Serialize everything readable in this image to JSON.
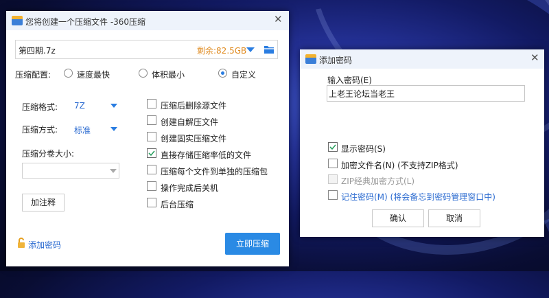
{
  "colors": {
    "accent": "#2a7de1",
    "free_space": "#e08b20",
    "title_bar": "#eef3fb",
    "wallpaper": "#121a63"
  },
  "compress_window": {
    "title": "您将创建一个压缩文件 -360压缩",
    "filename": "第四期.7z",
    "free_space": "剩余:82.5GB",
    "config_label": "压缩配置:",
    "config_options": [
      "速度最快",
      "体积最小",
      "自定义"
    ],
    "config_selected": "自定义",
    "format_label": "压缩格式:",
    "format_value": "7Z",
    "method_label": "压缩方式:",
    "method_value": "标准",
    "split_label": "压缩分卷大小:",
    "split_value": "",
    "comment_button": "加注释",
    "options": [
      {
        "label": "压缩后删除源文件",
        "checked": false
      },
      {
        "label": "创建自解压文件",
        "checked": false
      },
      {
        "label": "创建固实压缩文件",
        "checked": false
      },
      {
        "label": "直接存储压缩率低的文件",
        "checked": true
      },
      {
        "label": "压缩每个文件到单独的压缩包",
        "checked": false
      },
      {
        "label": "操作完成后关机",
        "checked": false
      },
      {
        "label": "后台压缩",
        "checked": false
      }
    ],
    "add_password_link": "添加密码",
    "compress_button": "立即压缩",
    "icons": [
      "archive-icon",
      "close-icon",
      "dropdown-arrow-icon",
      "folder-icon",
      "lock-icon"
    ]
  },
  "password_dialog": {
    "title": "添加密码",
    "input_label": "输入密码(E)",
    "password_value": "上老王论坛当老王",
    "show_password": {
      "label": "显示密码(S)",
      "checked": true
    },
    "encrypt_filename": {
      "label": "加密文件名(N) (不支持ZIP格式)",
      "checked": false
    },
    "zip_classic": {
      "label": "ZIP经典加密方式(L)",
      "checked": false,
      "disabled": true
    },
    "remember_password": {
      "label": "记住密码(M) (将会备忘到密码管理窗口中)",
      "checked": false
    },
    "ok_button": "确认",
    "cancel_button": "取消"
  }
}
